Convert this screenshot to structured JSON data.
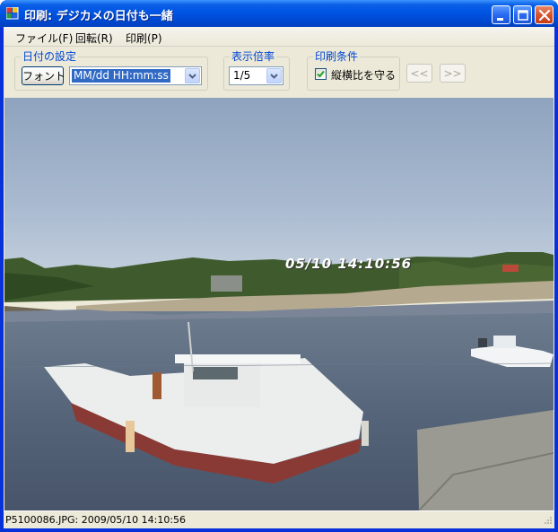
{
  "window": {
    "title": "印刷: デジカメの日付も一緒",
    "app_icon": "printer-app-icon",
    "controls": [
      "minimize-icon",
      "maximize-icon",
      "close-icon"
    ]
  },
  "menu": {
    "items": [
      {
        "label": "ファイル(F)"
      },
      {
        "label": "回転(R)"
      },
      {
        "label": "印刷(P)"
      }
    ]
  },
  "toolbar": {
    "date_group": {
      "label": "日付の設定",
      "font_button": "フォント",
      "format_value": "MM/dd HH:mm:ss"
    },
    "zoom_group": {
      "label": "表示倍率",
      "value": "1/5"
    },
    "print_group": {
      "label": "印刷条件",
      "keep_aspect_label": "縦横比を守る",
      "keep_aspect_checked": true,
      "prev_button": "<<",
      "next_button": ">>"
    }
  },
  "photo": {
    "date_stamp": "05/10 14:10:56"
  },
  "status": {
    "text": "P5100086.JPG: 2009/05/10 14:10:56"
  },
  "colors": {
    "title_bar": "#0054e3",
    "group_label": "#0046d5",
    "selection": "#316ac5",
    "window_bg": "#ece9d8"
  }
}
